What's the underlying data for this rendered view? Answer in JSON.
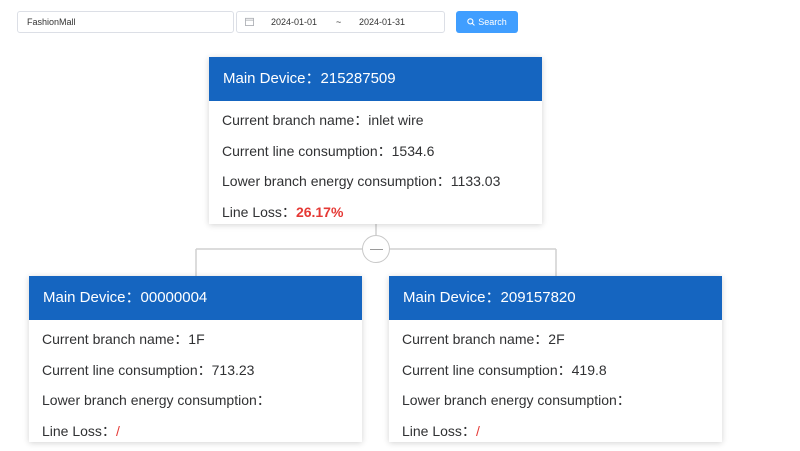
{
  "filters": {
    "mall_value": "FashionMall",
    "date_start": "2024-01-01",
    "date_separator": "~",
    "date_end": "2024-01-31",
    "search_label": "Search"
  },
  "labels": {
    "device": "Main Device：",
    "branch": "Current branch name：",
    "line_consumption": "Current line consumption：",
    "lower_consumption": "Lower branch energy consumption：",
    "line_loss": "Line Loss："
  },
  "root": {
    "device_id": "215287509",
    "branch_name": "inlet wire",
    "line_consumption": "1534.6",
    "lower_consumption": "1133.03",
    "line_loss": "26.17%"
  },
  "children": [
    {
      "device_id": "00000004",
      "branch_name": "1F",
      "line_consumption": "713.23",
      "lower_consumption": "",
      "line_loss": "/"
    },
    {
      "device_id": "209157820",
      "branch_name": "2F",
      "line_consumption": "419.8",
      "lower_consumption": "",
      "line_loss": "/"
    }
  ],
  "colors": {
    "header_blue": "#1565c0",
    "button_blue": "#409eff",
    "loss_red": "#e53935"
  },
  "icons": {
    "date": "calendar-icon",
    "search": "search-icon",
    "toggle": "collapse-icon"
  }
}
